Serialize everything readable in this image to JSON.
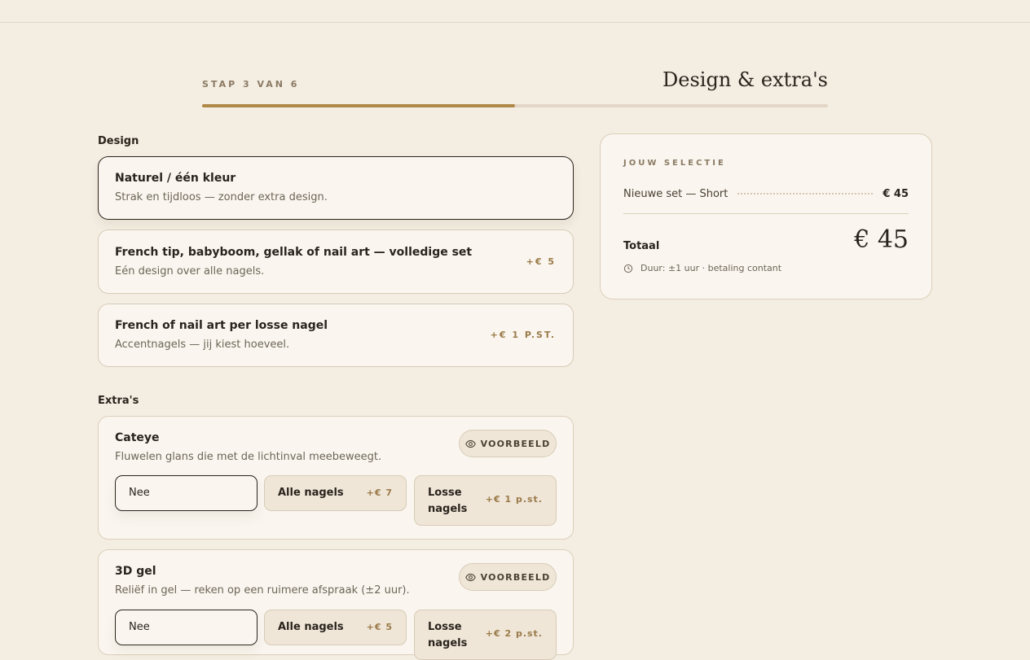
{
  "header": {
    "step_label": "STAP 3 VAN 6",
    "step_title": "Design & extra's",
    "progress": 0.5
  },
  "design": {
    "title": "Design",
    "options": [
      {
        "title": "Naturel / één kleur",
        "desc": "Strak en tijdloos — zonder extra design.",
        "price": "",
        "selected": true
      },
      {
        "title": "French tip, babyboom, gellak of nail art — volledige set",
        "desc": "Eén design over alle nagels.",
        "price": "+€ 5",
        "selected": false
      },
      {
        "title": "French of nail art per losse nagel",
        "desc": "Accentnagels — jij kiest hoeveel.",
        "price": "+€ 1 P.ST.",
        "selected": false
      }
    ]
  },
  "extras": {
    "title": "Extra's",
    "preview_label": "VOORBEELD",
    "items": [
      {
        "title": "Cateye",
        "desc": "Fluwelen glans die met de lichtinval meebeweegt.",
        "choices": [
          {
            "label": "Nee",
            "price": "",
            "selected": true
          },
          {
            "label": "Alle nagels",
            "price": "+€ 7",
            "selected": false
          },
          {
            "label": "Losse nagels",
            "price": "+€ 1 p.st.",
            "selected": false
          }
        ]
      },
      {
        "title": "3D gel",
        "desc": "Reliëf in gel — reken op een ruimere afspraak (±2 uur).",
        "choices": [
          {
            "label": "Nee",
            "price": "",
            "selected": true
          },
          {
            "label": "Alle nagels",
            "price": "+€ 5",
            "selected": false
          },
          {
            "label": "Losse nagels",
            "price": "+€ 2 p.st.",
            "selected": false
          }
        ]
      }
    ]
  },
  "summary": {
    "heading": "JOUW SELECTIE",
    "line_name": "Nieuwe set — Short",
    "line_value": "€ 45",
    "total_label": "Totaal",
    "total_value": "€ 45",
    "note": "Duur: ±1 uur · betaling contant"
  },
  "icons": {
    "preview": "eye-icon",
    "duration": "clock-icon"
  }
}
